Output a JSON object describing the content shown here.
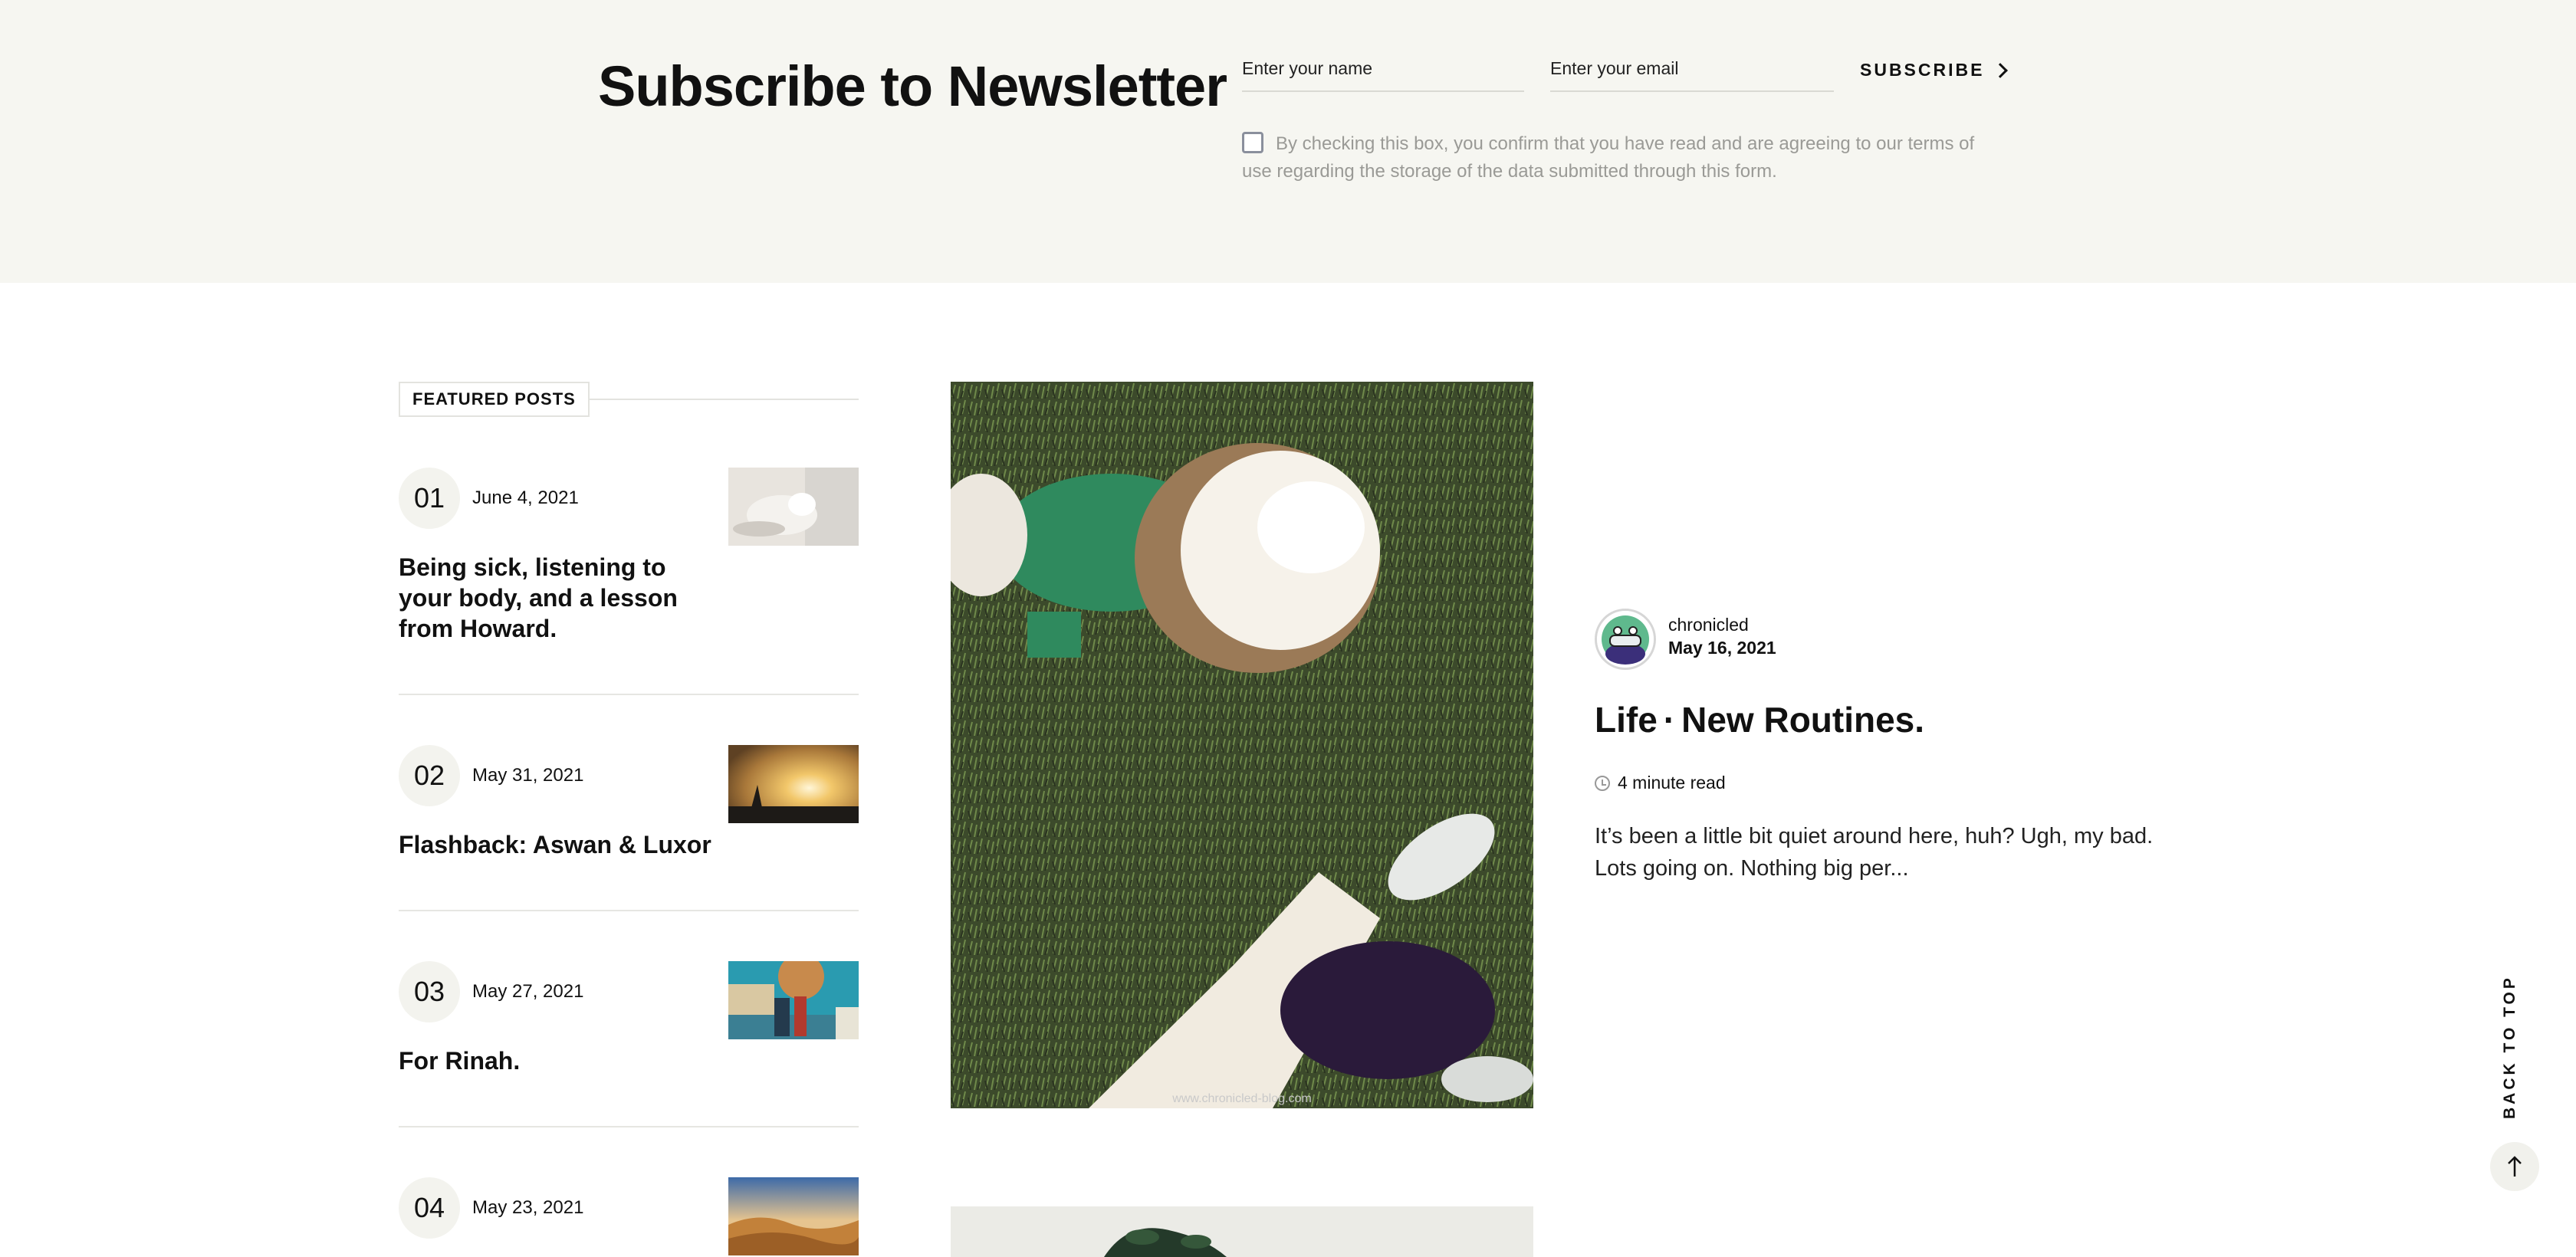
{
  "newsletter": {
    "title": "Subscribe to Newsletter",
    "name_placeholder": "Enter your name",
    "email_placeholder": "Enter your email",
    "submit_label": "SUBSCRIBE",
    "consent_text": "By checking this box, you confirm that you have read and are agreeing to our terms of use regarding the storage of the data submitted through this form."
  },
  "featured": {
    "header": "FEATURED POSTS",
    "posts": [
      {
        "number": "01",
        "date": "June 4, 2021",
        "title_strong": "Being sick, listening to",
        "title_rest": "your body, and a lesson from Howard."
      },
      {
        "number": "02",
        "date": "May 31, 2021",
        "title_strong": "Flashback: Aswan & Luxor",
        "title_rest": ""
      },
      {
        "number": "03",
        "date": "May 27, 2021",
        "title_strong": "For Rinah.",
        "title_rest": ""
      },
      {
        "number": "04",
        "date": "May 23, 2021",
        "title_strong": "",
        "title_rest": ""
      }
    ]
  },
  "article": {
    "author": "chronicled",
    "date": "May 16, 2021",
    "category": "Life",
    "separator": "·",
    "title": "New Routines.",
    "read_time": "4 minute read",
    "excerpt": "It’s been a little bit quiet around here, huh? Ugh, my bad. Lots going on. Nothing big per...",
    "image_watermark": "www.chronicled-blog.com"
  },
  "back_to_top": {
    "label": "BACK TO TOP"
  },
  "colors": {
    "newsletter_bg": "#f6f6f1",
    "text": "#111111",
    "muted": "#9a9a96",
    "circle_bg": "#f3f3ee"
  }
}
